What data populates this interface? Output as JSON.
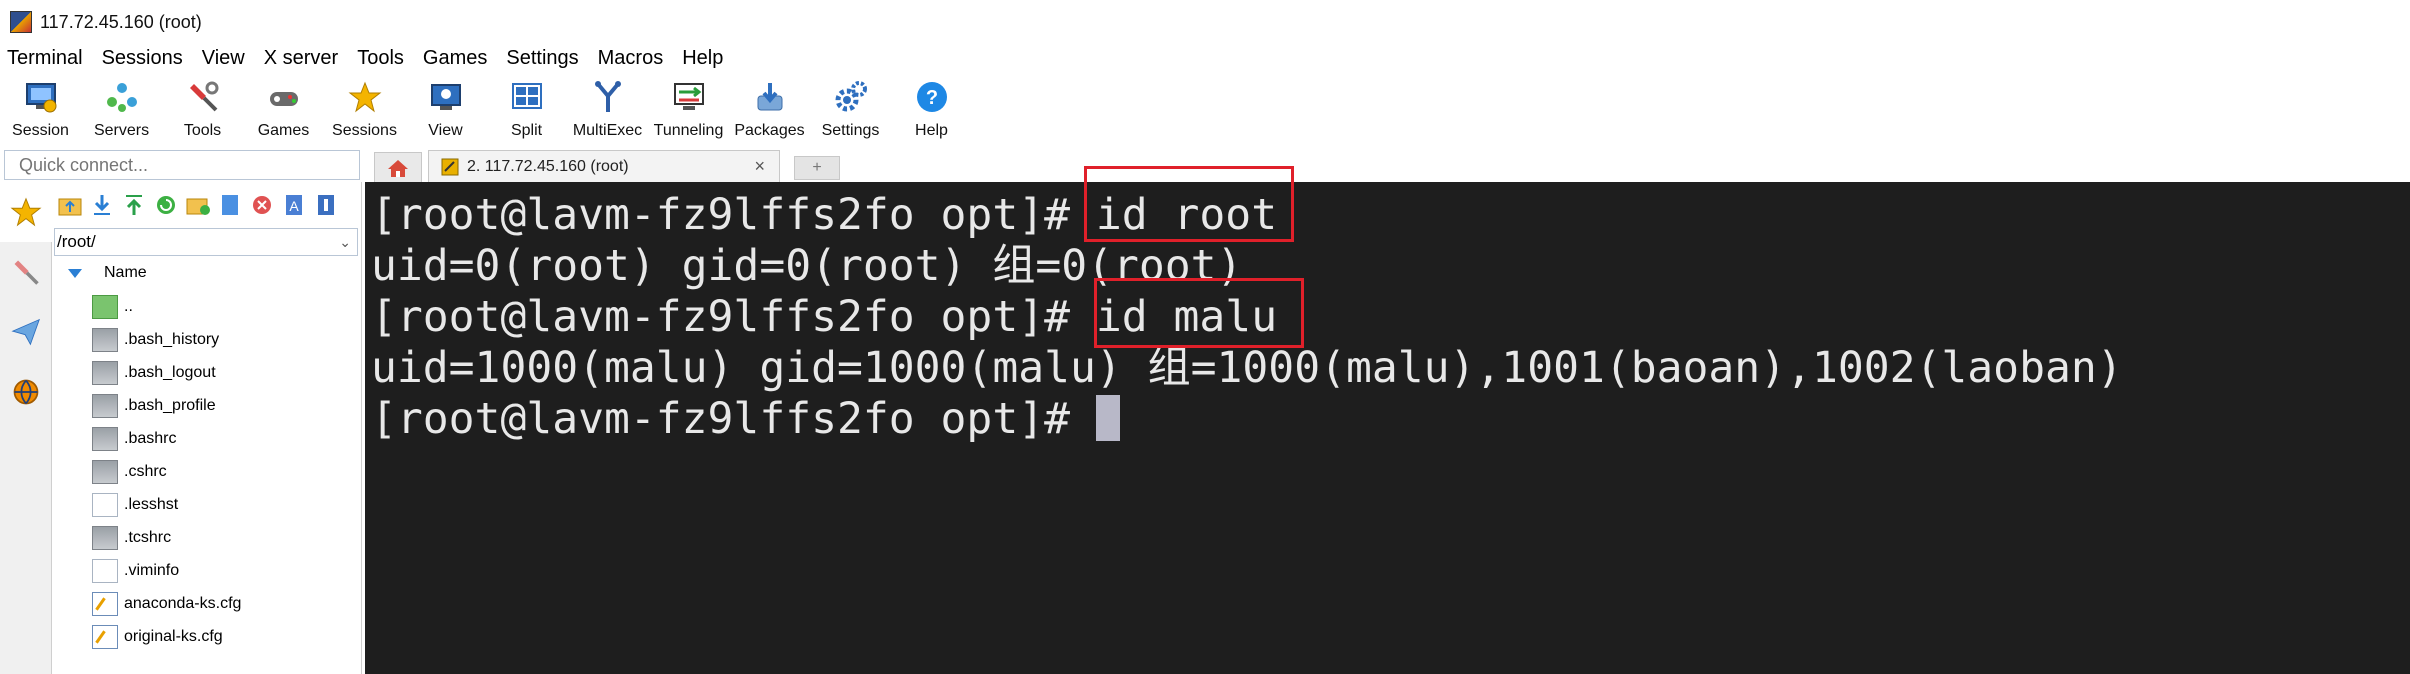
{
  "window": {
    "title": "117.72.45.160 (root)"
  },
  "menu": [
    "Terminal",
    "Sessions",
    "View",
    "X server",
    "Tools",
    "Games",
    "Settings",
    "Macros",
    "Help"
  ],
  "toolbar": [
    {
      "label": "Session",
      "icon": "session-icon"
    },
    {
      "label": "Servers",
      "icon": "servers-icon"
    },
    {
      "label": "Tools",
      "icon": "tools-icon"
    },
    {
      "label": "Games",
      "icon": "games-icon"
    },
    {
      "label": "Sessions",
      "icon": "star-icon"
    },
    {
      "label": "View",
      "icon": "view-icon"
    },
    {
      "label": "Split",
      "icon": "split-icon"
    },
    {
      "label": "MultiExec",
      "icon": "multiexec-icon"
    },
    {
      "label": "Tunneling",
      "icon": "tunneling-icon"
    },
    {
      "label": "Packages",
      "icon": "packages-icon"
    },
    {
      "label": "Settings",
      "icon": "gear-icon"
    },
    {
      "label": "Help",
      "icon": "help-icon"
    }
  ],
  "quick_connect": {
    "placeholder": "Quick connect..."
  },
  "file_browser": {
    "path": "/root/",
    "column_header": "Name",
    "items": [
      {
        "name": "..",
        "type": "folder"
      },
      {
        "name": ".bash_history",
        "type": "term"
      },
      {
        "name": ".bash_logout",
        "type": "term"
      },
      {
        "name": ".bash_profile",
        "type": "term"
      },
      {
        "name": ".bashrc",
        "type": "term"
      },
      {
        "name": ".cshrc",
        "type": "term"
      },
      {
        "name": ".lesshst",
        "type": "doc"
      },
      {
        "name": ".tcshrc",
        "type": "term"
      },
      {
        "name": ".viminfo",
        "type": "doc"
      },
      {
        "name": "anaconda-ks.cfg",
        "type": "cfg"
      },
      {
        "name": "original-ks.cfg",
        "type": "cfg"
      }
    ]
  },
  "tabs": {
    "active": "2. 117.72.45.160 (root)"
  },
  "terminal": {
    "lines": [
      "[root@lavm-fz9lffs2fo opt]# id root",
      "uid=0(root) gid=0(root) 组=0(root)",
      "[root@lavm-fz9lffs2fo opt]# id malu",
      "uid=1000(malu) gid=1000(malu) 组=1000(malu),1001(baoan),1002(laoban)",
      "[root@lavm-fz9lffs2fo opt]# "
    ]
  },
  "colors": {
    "terminal_bg": "#1e1e1e",
    "terminal_fg": "#e8e8e8",
    "highlight": "#e0202a"
  }
}
